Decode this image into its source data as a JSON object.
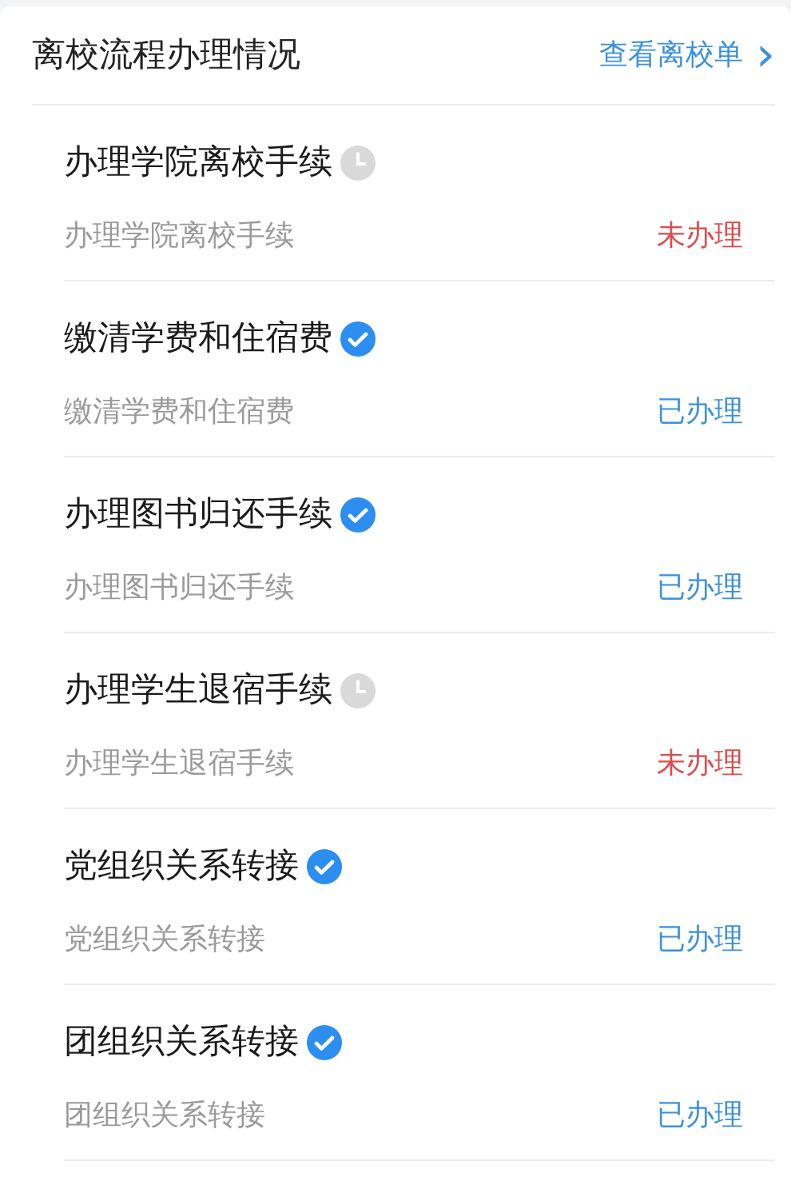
{
  "header": {
    "title": "离校流程办理情况",
    "link": "查看离校单",
    "arrow": "›"
  },
  "items": [
    {
      "title": "办理学院离校手续",
      "subtitle": "办理学院离校手续",
      "status": "未办理",
      "done": false
    },
    {
      "title": "缴清学费和住宿费",
      "subtitle": "缴清学费和住宿费",
      "status": "已办理",
      "done": true
    },
    {
      "title": "办理图书归还手续",
      "subtitle": "办理图书归还手续",
      "status": "已办理",
      "done": true
    },
    {
      "title": "办理学生退宿手续",
      "subtitle": "办理学生退宿手续",
      "status": "未办理",
      "done": false
    },
    {
      "title": "党组织关系转接",
      "subtitle": "党组织关系转接",
      "status": "已办理",
      "done": true
    },
    {
      "title": "团组织关系转接",
      "subtitle": "团组织关系转接",
      "status": "已办理",
      "done": true
    }
  ]
}
